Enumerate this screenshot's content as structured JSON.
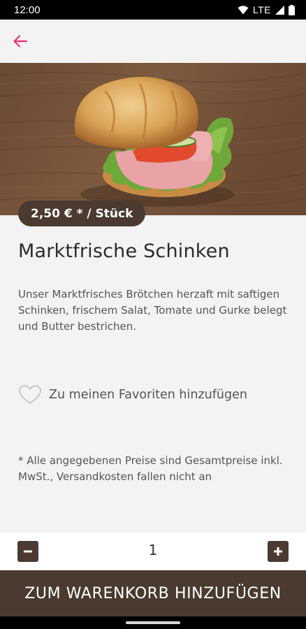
{
  "status_bar": {
    "time": "12:00",
    "network": "LTE"
  },
  "app_bar": {
    "back_icon": "arrow-left-icon",
    "accent_color": "#e8336d"
  },
  "product": {
    "price_label": "2,50 € * / Stück",
    "title": "Marktfrische Schinken",
    "description": "Unser Marktfrisches Brötchen herzaft mit saftigen Schinken, frischem Salat, Tomate und Gurke belegt und Butter bestrichen.",
    "image": "sandwich-roll-with-ham-lettuce-tomato-cucumber"
  },
  "favorite": {
    "icon": "heart-outline-icon",
    "label": "Zu meinen Favoriten hinzufügen"
  },
  "price_note": "* Alle angegebenen Preise sind Gesamtpreise inkl. MwSt., Versandkosten fallen nicht an",
  "quantity": {
    "value": "1",
    "minus_icon": "minus-icon",
    "plus_icon": "plus-icon"
  },
  "cart_button": {
    "label": "ZUM WARENKORB HINZUFÜGEN"
  },
  "colors": {
    "brand_brown": "#4a3a2f",
    "background": "#f3f3f3"
  }
}
